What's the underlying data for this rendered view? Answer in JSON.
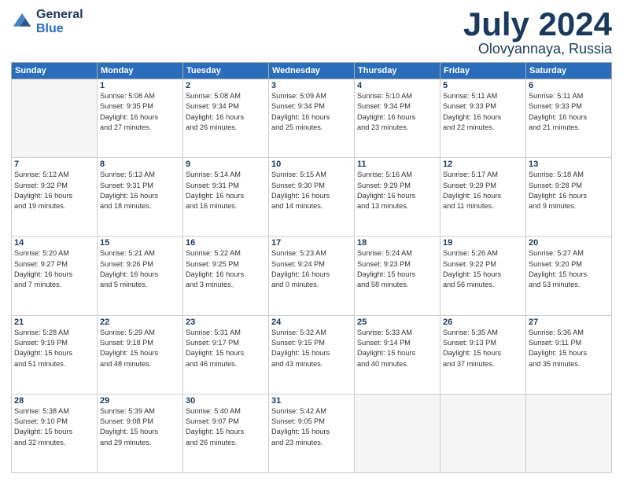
{
  "header": {
    "logo_line1": "General",
    "logo_line2": "Blue",
    "month": "July 2024",
    "location": "Olovyannaya, Russia"
  },
  "weekdays": [
    "Sunday",
    "Monday",
    "Tuesday",
    "Wednesday",
    "Thursday",
    "Friday",
    "Saturday"
  ],
  "days": [
    {
      "num": "",
      "detail": ""
    },
    {
      "num": "1",
      "detail": "Sunrise: 5:08 AM\nSunset: 9:35 PM\nDaylight: 16 hours\nand 27 minutes."
    },
    {
      "num": "2",
      "detail": "Sunrise: 5:08 AM\nSunset: 9:34 PM\nDaylight: 16 hours\nand 26 minutes."
    },
    {
      "num": "3",
      "detail": "Sunrise: 5:09 AM\nSunset: 9:34 PM\nDaylight: 16 hours\nand 25 minutes."
    },
    {
      "num": "4",
      "detail": "Sunrise: 5:10 AM\nSunset: 9:34 PM\nDaylight: 16 hours\nand 23 minutes."
    },
    {
      "num": "5",
      "detail": "Sunrise: 5:11 AM\nSunset: 9:33 PM\nDaylight: 16 hours\nand 22 minutes."
    },
    {
      "num": "6",
      "detail": "Sunrise: 5:11 AM\nSunset: 9:33 PM\nDaylight: 16 hours\nand 21 minutes."
    },
    {
      "num": "7",
      "detail": "Sunrise: 5:12 AM\nSunset: 9:32 PM\nDaylight: 16 hours\nand 19 minutes."
    },
    {
      "num": "8",
      "detail": "Sunrise: 5:13 AM\nSunset: 9:31 PM\nDaylight: 16 hours\nand 18 minutes."
    },
    {
      "num": "9",
      "detail": "Sunrise: 5:14 AM\nSunset: 9:31 PM\nDaylight: 16 hours\nand 16 minutes."
    },
    {
      "num": "10",
      "detail": "Sunrise: 5:15 AM\nSunset: 9:30 PM\nDaylight: 16 hours\nand 14 minutes."
    },
    {
      "num": "11",
      "detail": "Sunrise: 5:16 AM\nSunset: 9:29 PM\nDaylight: 16 hours\nand 13 minutes."
    },
    {
      "num": "12",
      "detail": "Sunrise: 5:17 AM\nSunset: 9:29 PM\nDaylight: 16 hours\nand 11 minutes."
    },
    {
      "num": "13",
      "detail": "Sunrise: 5:18 AM\nSunset: 9:28 PM\nDaylight: 16 hours\nand 9 minutes."
    },
    {
      "num": "14",
      "detail": "Sunrise: 5:20 AM\nSunset: 9:27 PM\nDaylight: 16 hours\nand 7 minutes."
    },
    {
      "num": "15",
      "detail": "Sunrise: 5:21 AM\nSunset: 9:26 PM\nDaylight: 16 hours\nand 5 minutes."
    },
    {
      "num": "16",
      "detail": "Sunrise: 5:22 AM\nSunset: 9:25 PM\nDaylight: 16 hours\nand 3 minutes."
    },
    {
      "num": "17",
      "detail": "Sunrise: 5:23 AM\nSunset: 9:24 PM\nDaylight: 16 hours\nand 0 minutes."
    },
    {
      "num": "18",
      "detail": "Sunrise: 5:24 AM\nSunset: 9:23 PM\nDaylight: 15 hours\nand 58 minutes."
    },
    {
      "num": "19",
      "detail": "Sunrise: 5:26 AM\nSunset: 9:22 PM\nDaylight: 15 hours\nand 56 minutes."
    },
    {
      "num": "20",
      "detail": "Sunrise: 5:27 AM\nSunset: 9:20 PM\nDaylight: 15 hours\nand 53 minutes."
    },
    {
      "num": "21",
      "detail": "Sunrise: 5:28 AM\nSunset: 9:19 PM\nDaylight: 15 hours\nand 51 minutes."
    },
    {
      "num": "22",
      "detail": "Sunrise: 5:29 AM\nSunset: 9:18 PM\nDaylight: 15 hours\nand 48 minutes."
    },
    {
      "num": "23",
      "detail": "Sunrise: 5:31 AM\nSunset: 9:17 PM\nDaylight: 15 hours\nand 46 minutes."
    },
    {
      "num": "24",
      "detail": "Sunrise: 5:32 AM\nSunset: 9:15 PM\nDaylight: 15 hours\nand 43 minutes."
    },
    {
      "num": "25",
      "detail": "Sunrise: 5:33 AM\nSunset: 9:14 PM\nDaylight: 15 hours\nand 40 minutes."
    },
    {
      "num": "26",
      "detail": "Sunrise: 5:35 AM\nSunset: 9:13 PM\nDaylight: 15 hours\nand 37 minutes."
    },
    {
      "num": "27",
      "detail": "Sunrise: 5:36 AM\nSunset: 9:11 PM\nDaylight: 15 hours\nand 35 minutes."
    },
    {
      "num": "28",
      "detail": "Sunrise: 5:38 AM\nSunset: 9:10 PM\nDaylight: 15 hours\nand 32 minutes."
    },
    {
      "num": "29",
      "detail": "Sunrise: 5:39 AM\nSunset: 9:08 PM\nDaylight: 15 hours\nand 29 minutes."
    },
    {
      "num": "30",
      "detail": "Sunrise: 5:40 AM\nSunset: 9:07 PM\nDaylight: 15 hours\nand 26 minutes."
    },
    {
      "num": "31",
      "detail": "Sunrise: 5:42 AM\nSunset: 9:05 PM\nDaylight: 15 hours\nand 23 minutes."
    },
    {
      "num": "",
      "detail": ""
    },
    {
      "num": "",
      "detail": ""
    },
    {
      "num": "",
      "detail": ""
    },
    {
      "num": "",
      "detail": ""
    }
  ]
}
